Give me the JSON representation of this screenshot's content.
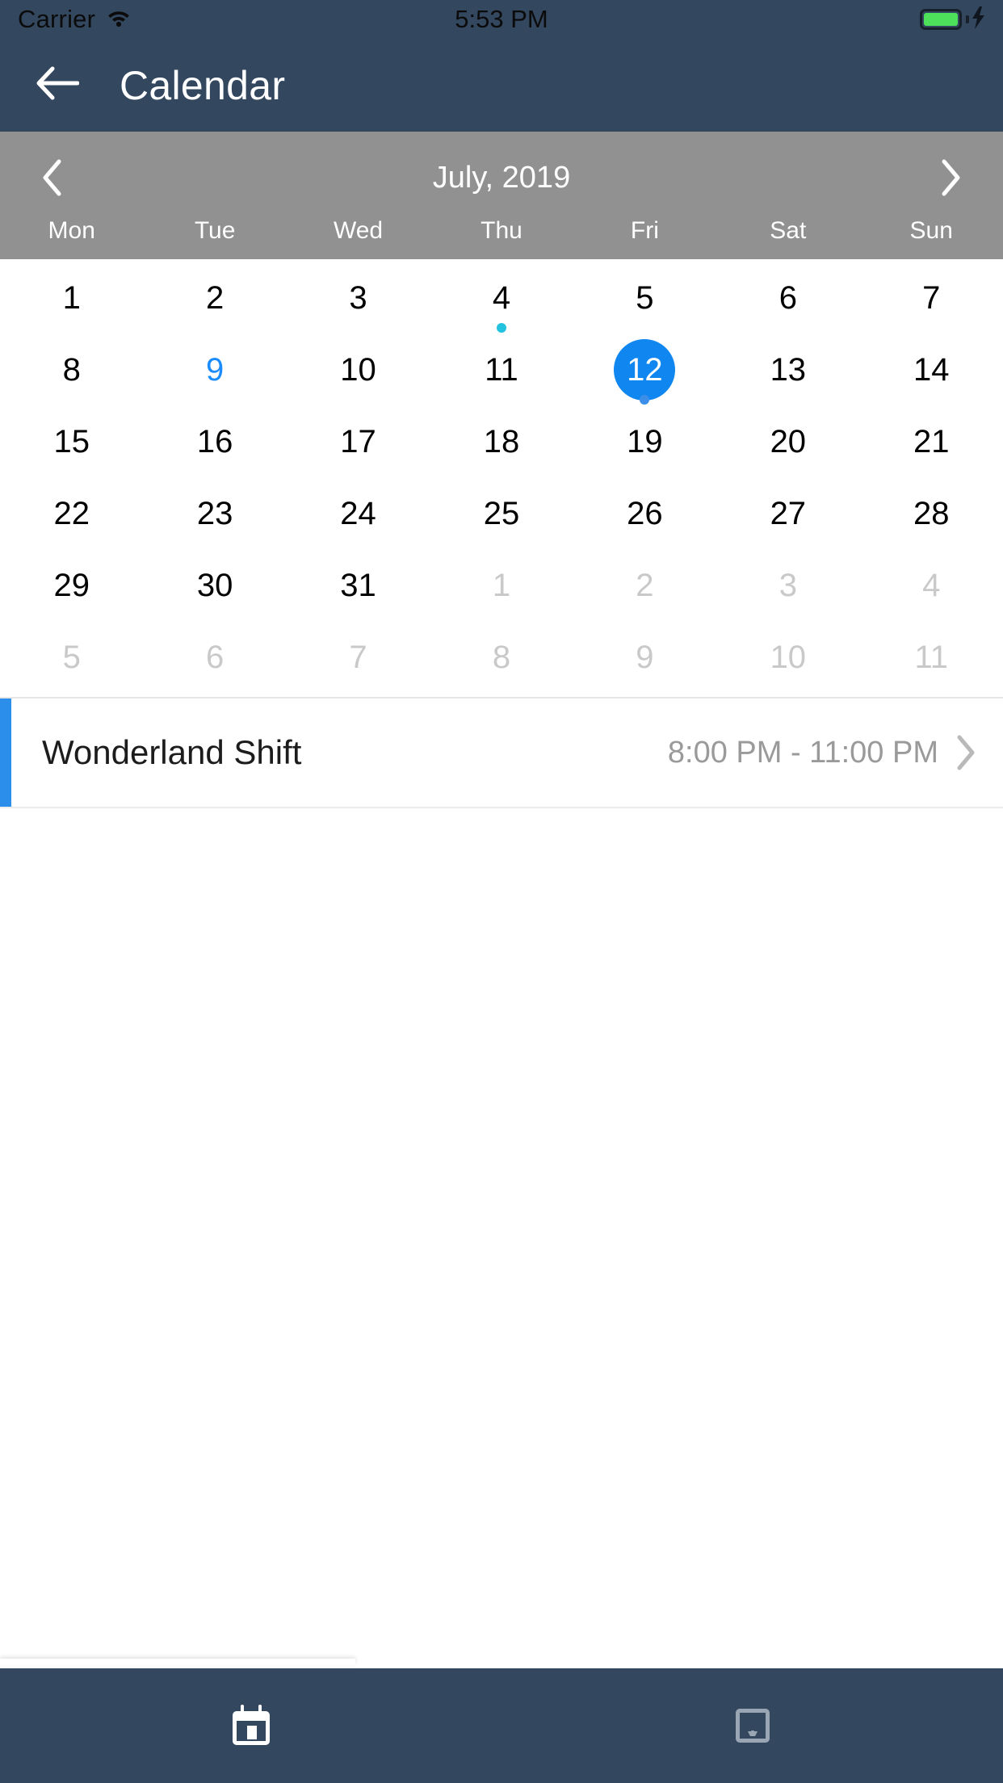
{
  "status_bar": {
    "carrier": "Carrier",
    "time": "5:53 PM",
    "wifi_icon": "wifi-icon",
    "battery_icon": "battery-full-icon",
    "charging_icon": "lightning-bolt-icon",
    "battery_color": "#4CE05B",
    "background": "#33475F"
  },
  "nav_bar": {
    "back_icon": "arrow-left-icon",
    "title": "Calendar",
    "background": "#33475F",
    "text_color": "#FFFFFF"
  },
  "month_header": {
    "prev_icon": "chevron-left-icon",
    "next_icon": "chevron-right-icon",
    "label": "July, 2019",
    "background": "#919191",
    "weekdays": [
      "Mon",
      "Tue",
      "Wed",
      "Thu",
      "Fri",
      "Sat",
      "Sun"
    ]
  },
  "calendar": {
    "selected_day": "12",
    "today": "9",
    "selected_bg": "#1086F0",
    "today_color": "#1A8CFF",
    "muted_color": "#C9C9C9",
    "weeks": [
      [
        {
          "day": "1",
          "state": "normal"
        },
        {
          "day": "2",
          "state": "normal"
        },
        {
          "day": "3",
          "state": "normal"
        },
        {
          "day": "4",
          "state": "normal",
          "dot": "#23C3E0"
        },
        {
          "day": "5",
          "state": "normal"
        },
        {
          "day": "6",
          "state": "normal"
        },
        {
          "day": "7",
          "state": "normal"
        }
      ],
      [
        {
          "day": "8",
          "state": "normal"
        },
        {
          "day": "9",
          "state": "today"
        },
        {
          "day": "10",
          "state": "normal"
        },
        {
          "day": "11",
          "state": "normal"
        },
        {
          "day": "12",
          "state": "selected",
          "dot": "#3B8FE8"
        },
        {
          "day": "13",
          "state": "normal"
        },
        {
          "day": "14",
          "state": "normal"
        }
      ],
      [
        {
          "day": "15",
          "state": "normal"
        },
        {
          "day": "16",
          "state": "normal"
        },
        {
          "day": "17",
          "state": "normal"
        },
        {
          "day": "18",
          "state": "normal"
        },
        {
          "day": "19",
          "state": "normal"
        },
        {
          "day": "20",
          "state": "normal"
        },
        {
          "day": "21",
          "state": "normal"
        }
      ],
      [
        {
          "day": "22",
          "state": "normal"
        },
        {
          "day": "23",
          "state": "normal"
        },
        {
          "day": "24",
          "state": "normal"
        },
        {
          "day": "25",
          "state": "normal"
        },
        {
          "day": "26",
          "state": "normal"
        },
        {
          "day": "27",
          "state": "normal"
        },
        {
          "day": "28",
          "state": "normal"
        }
      ],
      [
        {
          "day": "29",
          "state": "normal"
        },
        {
          "day": "30",
          "state": "normal"
        },
        {
          "day": "31",
          "state": "normal"
        },
        {
          "day": "1",
          "state": "muted"
        },
        {
          "day": "2",
          "state": "muted"
        },
        {
          "day": "3",
          "state": "muted"
        },
        {
          "day": "4",
          "state": "muted"
        }
      ],
      [
        {
          "day": "5",
          "state": "muted"
        },
        {
          "day": "6",
          "state": "muted"
        },
        {
          "day": "7",
          "state": "muted"
        },
        {
          "day": "8",
          "state": "muted"
        },
        {
          "day": "9",
          "state": "muted"
        },
        {
          "day": "10",
          "state": "muted"
        },
        {
          "day": "11",
          "state": "muted"
        }
      ]
    ]
  },
  "events": [
    {
      "title": "Wonderland Shift",
      "time": "8:00 PM - 11:00 PM",
      "accent_color": "#2B8EEA",
      "chevron_icon": "chevron-right-icon"
    }
  ],
  "tab_bar": {
    "background": "#33475F",
    "items": [
      {
        "icon": "calendar-icon",
        "active": true
      },
      {
        "icon": "inbox-tray-icon",
        "active": false
      }
    ]
  }
}
